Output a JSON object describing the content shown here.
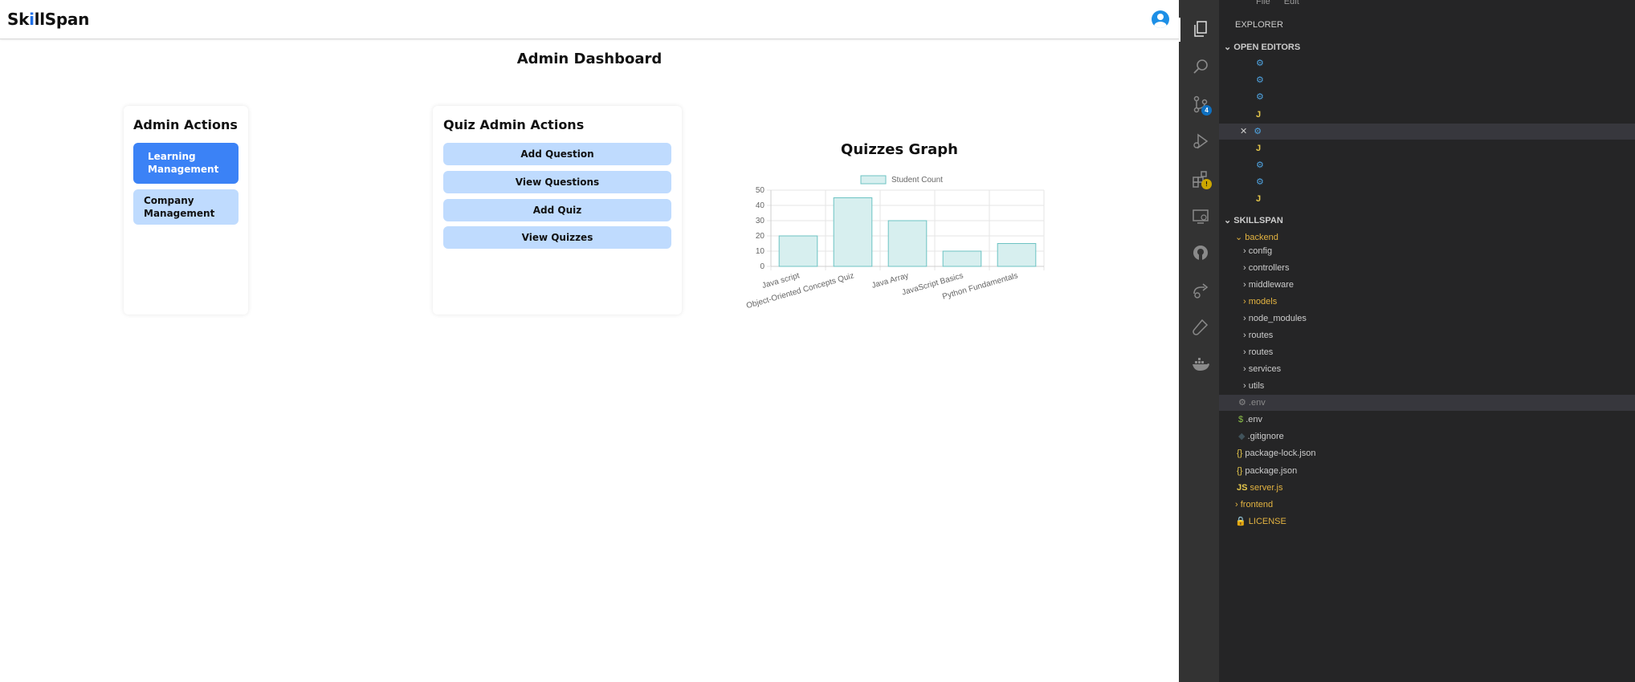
{
  "header": {
    "brand_pre": "Sk",
    "brand_i": "i",
    "brand_post": "llSpan",
    "avatar_icon": "user-avatar-icon"
  },
  "page": {
    "title": "Admin Dashboard"
  },
  "admin_actions": {
    "title": "Admin Actions",
    "items": [
      {
        "label": "Learning Management",
        "active": true
      },
      {
        "label": "Company Management",
        "active": false
      }
    ]
  },
  "quiz_admin": {
    "title": "Quiz Admin Actions",
    "buttons": [
      "Add Question",
      "View Questions",
      "Add Quiz",
      "View Quizzes"
    ]
  },
  "graph": {
    "title": "Quizzes Graph"
  },
  "chart_data": {
    "type": "bar",
    "title": "Quizzes Graph",
    "categories": [
      "Java script",
      "Object-Oriented Concepts Quiz",
      "Java Array",
      "JavaScript Basics",
      "Python Fundamentals"
    ],
    "series": [
      {
        "name": "Student Count",
        "values": [
          20,
          45,
          30,
          10,
          15
        ]
      }
    ],
    "ylim": [
      0,
      50
    ],
    "yticks": [
      0,
      10,
      20,
      30,
      40,
      50
    ],
    "grid": true,
    "legend": "top-center",
    "colors": {
      "fill": "#d7efef",
      "stroke": "#6cc3c3"
    }
  },
  "vscode": {
    "menu": [
      "File",
      "Edit"
    ],
    "explorer_title": "EXPLORER",
    "open_editors": "OPEN EDITORS",
    "project": "SKILLSPAN",
    "backend_folder": "backend",
    "scm_badge": "4",
    "folders": [
      "config",
      "controllers",
      "middleware",
      "models",
      "node_modules",
      "routes",
      "routes",
      "services",
      "utils"
    ],
    "files": [
      ".env",
      ".env",
      ".gitignore",
      "package-lock.json",
      "package.json",
      "server.js"
    ],
    "frontend_folder": "frontend",
    "license": "LICENSE"
  }
}
